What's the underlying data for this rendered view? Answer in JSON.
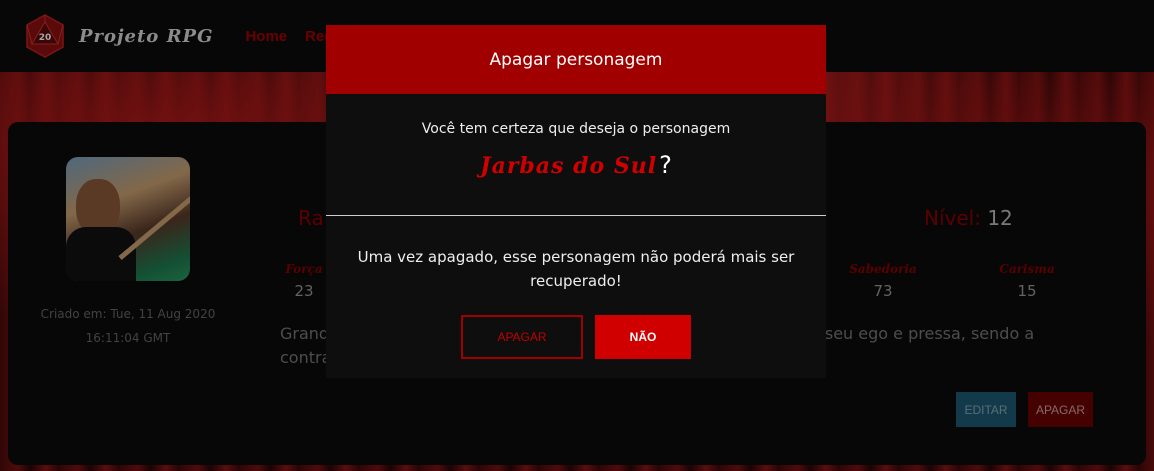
{
  "navbar": {
    "logo_number": "20",
    "brand": "Projeto RPG",
    "links": [
      "Home",
      "Regis"
    ]
  },
  "character": {
    "created_line1": "Criado em: Tue, 11 Aug 2020",
    "created_line2": "16:11:04 GMT",
    "race_label": "Ra",
    "level_label": "Nível:",
    "level_value": "12",
    "stats": [
      {
        "name": "Força",
        "value": "23"
      },
      {
        "name": "Sabedoria",
        "value": "73"
      },
      {
        "name": "Carisma",
        "value": "15"
      }
    ],
    "desc_left_1": "Grand",
    "desc_right_1": "o seu ego e pressa, sendo a",
    "desc_left_2": "contra",
    "edit_label": "EDITAR",
    "delete_label": "APAGAR"
  },
  "modal": {
    "title": "Apagar personagem",
    "question": "Você tem certeza que deseja o personagem",
    "character_name": "Jarbas do Sul",
    "question_mark": "?",
    "warning": "Uma vez apagado, esse personagem não poderá mais ser recuperado!",
    "confirm_label": "APAGAR",
    "cancel_label": "NÃO"
  },
  "colors": {
    "accent": "#a00000",
    "bright_red": "#d00000",
    "card_bg": "#0b0b0b",
    "edit_btn": "#1d5a73"
  }
}
